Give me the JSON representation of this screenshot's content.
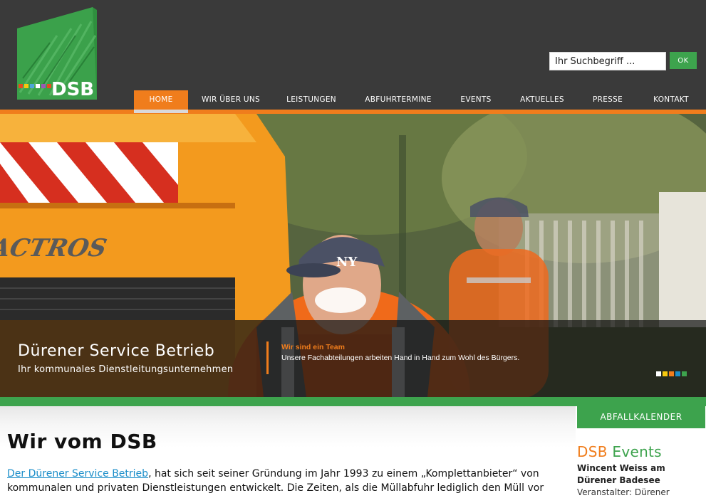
{
  "logo": {
    "text": "DSB",
    "icon": "dsb-logo-house-stripes",
    "colors": {
      "green": "#3da34d",
      "stripes": [
        "#e84b1e",
        "#f6c90e",
        "#4fa6d9",
        "#3da34d",
        "#9b59b6"
      ]
    }
  },
  "search": {
    "placeholder": "Ihr Suchbegriff ...",
    "button_label": "OK"
  },
  "nav": {
    "items": [
      {
        "label": "HOME",
        "active": true
      },
      {
        "label": "WIR ÜBER UNS"
      },
      {
        "label": "LEISTUNGEN"
      },
      {
        "label": "ABFUHRTERMINE"
      },
      {
        "label": "EVENTS"
      },
      {
        "label": "AKTUELLES"
      },
      {
        "label": "PRESSE"
      },
      {
        "label": "KONTAKT"
      }
    ]
  },
  "hero": {
    "image": "photo-smiling-workers-orange-uniform-actros-truck",
    "truck_label": "ACTROS",
    "cap_logo": "NY",
    "title": "Dürener Service Betrieb",
    "subtitle": "Ihr kommunales Dienstleitungsunternehmen",
    "team_title": "Wir sind ein Team",
    "team_text": "Unsere Fachabteilungen arbeiten Hand in Hand zum Wohl des Bürgers.",
    "slide_dots": [
      "#ffffff",
      "#f6c90e",
      "#f07d1c",
      "#1a8dc9",
      "#3da34d"
    ]
  },
  "main": {
    "title": "Wir vom DSB",
    "intro_link": "Der Dürener Service Betrieb",
    "intro_text": ", hat sich seit seiner Gründung im Jahr 1993 zu einem „Komplettanbieter“ von kommunalen und privaten Dienstleistungen entwickelt. Die Zeiten, als die Müllabfuhr lediglich den Müll vor"
  },
  "sidebar": {
    "abfall_label": "ABFALLKALENDER",
    "events_heading_dsb": "DSB",
    "events_heading_events": "Events",
    "event_title": "Wincent Weiss am Dürener Badesee",
    "event_meta": "Veranstalter: Dürener"
  },
  "colors": {
    "orange": "#f07d1c",
    "green": "#3da34d",
    "header_bg": "#3a3a3a",
    "link": "#1a8dc9"
  }
}
